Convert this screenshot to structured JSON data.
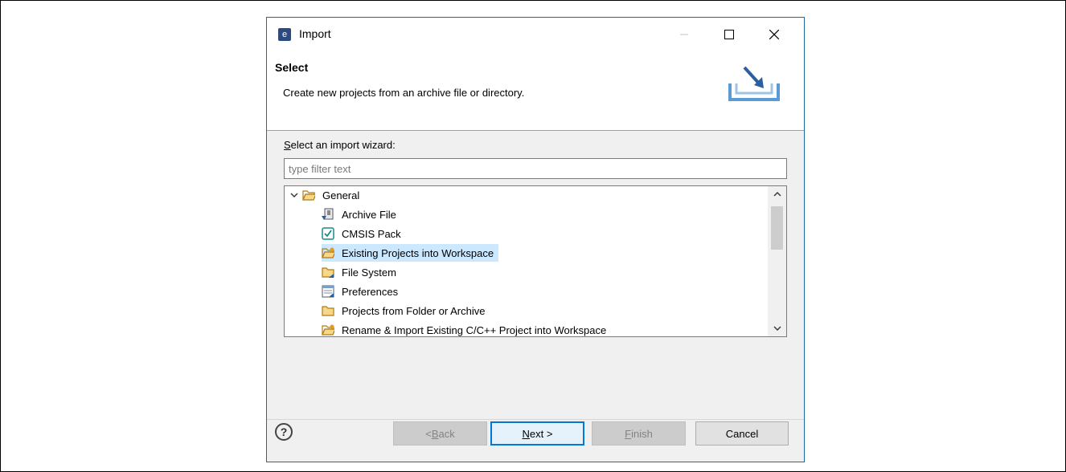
{
  "window": {
    "title": "Import"
  },
  "header": {
    "title": "Select",
    "description": "Create new projects from an archive file or directory."
  },
  "wizard": {
    "label_prefix": "S",
    "label_rest": "elect an import wizard:",
    "filter_placeholder": "type filter text"
  },
  "tree": {
    "group_label": "General",
    "items": [
      {
        "label": "Archive File",
        "icon": "archive-file-icon"
      },
      {
        "label": "CMSIS Pack",
        "icon": "checkbox-pack-icon"
      },
      {
        "label": "Existing Projects into Workspace",
        "icon": "project-folder-icon",
        "selected": true
      },
      {
        "label": "File System",
        "icon": "folder-icon"
      },
      {
        "label": "Preferences",
        "icon": "preferences-icon"
      },
      {
        "label": "Projects from Folder or Archive",
        "icon": "folder-icon"
      },
      {
        "label": "Rename & Import Existing C/C++ Project into Workspace",
        "icon": "project-folder-icon"
      }
    ]
  },
  "buttons": {
    "back_prefix": "< ",
    "back_mnemonic": "B",
    "back_rest": "ack",
    "next_mnemonic": "N",
    "next_rest": "ext >",
    "finish_mnemonic": "F",
    "finish_rest": "inish",
    "cancel": "Cancel",
    "help": "?"
  },
  "colors": {
    "accent": "#0078d7",
    "selection": "#cce8ff",
    "border": "#1b6aa5"
  }
}
